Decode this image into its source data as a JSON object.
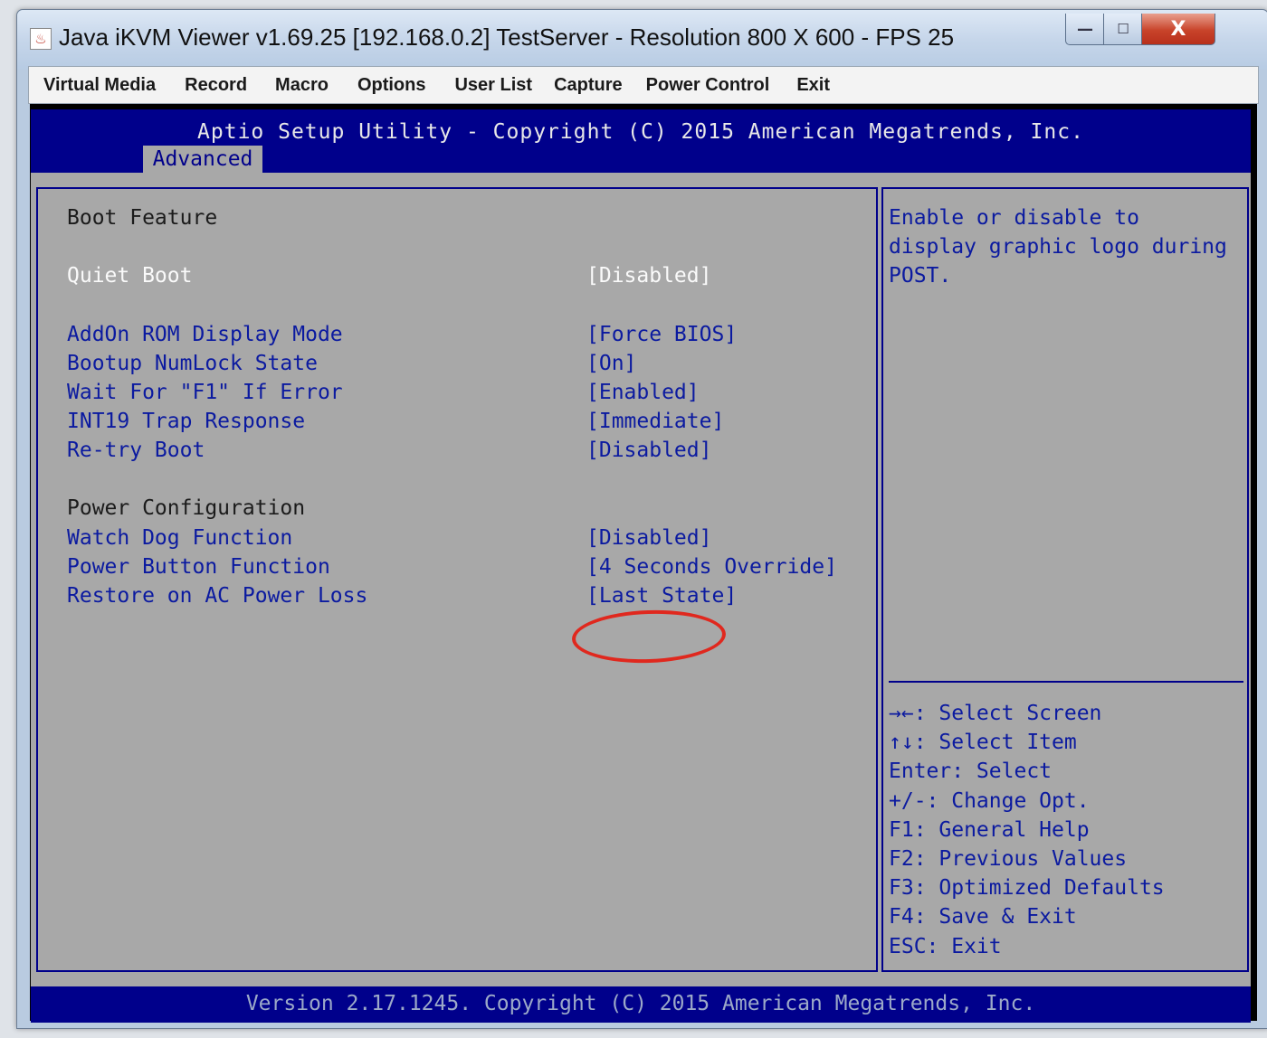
{
  "window": {
    "title": "Java iKVM Viewer v1.69.25 [192.168.0.2] TestServer - Resolution 800 X 600 - FPS 25",
    "icon": "java-icon",
    "controls": {
      "minimize": "—",
      "maximize": "☐",
      "close": "X"
    }
  },
  "menubar": {
    "items": [
      "Virtual Media",
      "Record",
      "Macro",
      "Options",
      "User List",
      "Capture",
      "Power Control",
      "Exit"
    ]
  },
  "bios": {
    "header_title": "Aptio Setup Utility - Copyright (C) 2015 American Megatrends, Inc.",
    "active_tab": "Advanced",
    "section_boot": "Boot Feature",
    "settings": [
      {
        "label": "Quiet Boot",
        "value": "[Disabled]"
      },
      {
        "label": "AddOn ROM Display Mode",
        "value": "[Force BIOS]"
      },
      {
        "label": "Bootup NumLock State",
        "value": "[On]"
      },
      {
        "label": "Wait For \"F1\" If Error",
        "value": "[Enabled]"
      },
      {
        "label": "INT19 Trap Response",
        "value": "[Immediate]"
      },
      {
        "label": "Re-try Boot",
        "value": "[Disabled]"
      },
      {
        "label": "Watch Dog Function",
        "value": "[Disabled]"
      },
      {
        "label": "Power Button Function",
        "value": "[4 Seconds Override]"
      },
      {
        "label": "Restore on AC Power Loss",
        "value": "[Last State]"
      }
    ],
    "section_power": "Power Configuration",
    "help": {
      "line1": "Enable or disable to",
      "line2": "display graphic logo during",
      "line3": "POST."
    },
    "keys": [
      "→←: Select Screen",
      "↑↓: Select Item",
      "Enter: Select",
      "+/-: Change Opt.",
      "F1: General Help",
      "F2: Previous Values",
      "F3: Optimized Defaults",
      "F4: Save & Exit",
      "ESC: Exit"
    ],
    "footer": "Version 2.17.1245. Copyright (C) 2015 American Megatrends, Inc."
  },
  "colors": {
    "bios_blue": "#00008b",
    "bios_gray": "#a8a8a8",
    "annotation_red": "#e0281e"
  }
}
